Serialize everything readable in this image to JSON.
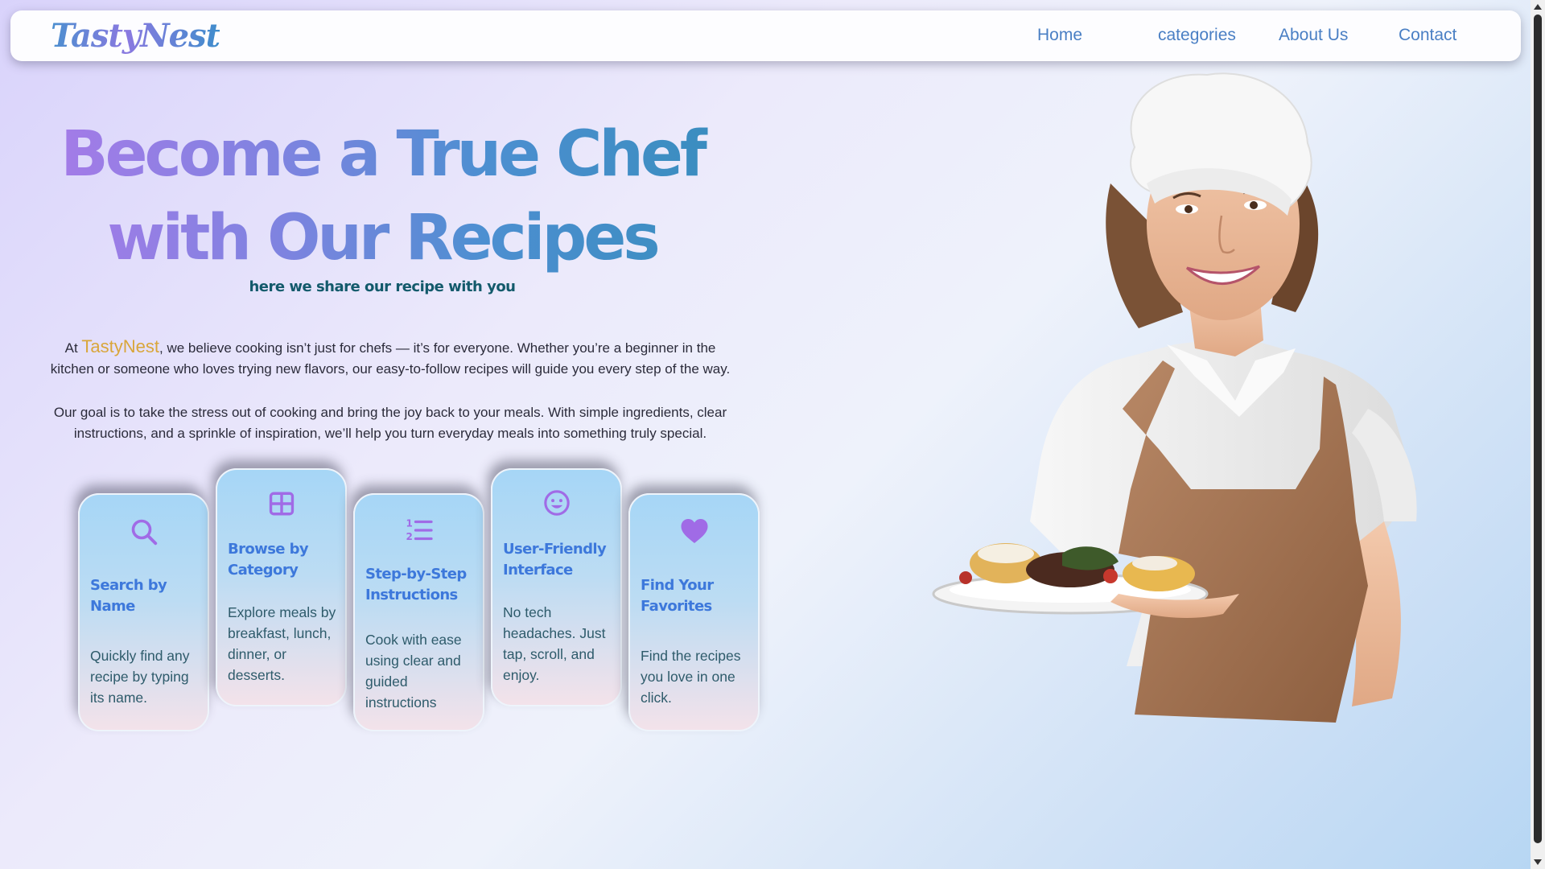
{
  "navbar": {
    "logo": "TastyNest",
    "links": [
      "Home",
      "categories",
      "About Us",
      "Contact"
    ]
  },
  "hero": {
    "title_line1": "Become a True Chef",
    "title_line2": "with Our Recipes",
    "subtitle": "here we share our recipe with you",
    "para1_prefix": "At ",
    "para1_brand": "TastyNest",
    "para1_rest": ", we believe cooking isn’t just for chefs — it’s for everyone. Whether you’re a beginner in the kitchen or someone who loves trying new flavors, our easy-to-follow recipes will guide you every step of the way.",
    "para2": "Our goal is to take the stress out of cooking and bring the joy back to your meals. With simple ingredients, clear instructions, and a sprinkle of inspiration, we’ll help you turn everyday meals into something truly special."
  },
  "features": [
    {
      "icon": "search-icon",
      "title": "Search by Name",
      "text": "Quickly find any recipe by typing its name."
    },
    {
      "icon": "grid-icon",
      "title": "Browse by Category",
      "text": "Explore meals by breakfast, lunch, dinner, or desserts."
    },
    {
      "icon": "list-numbers-icon",
      "title": "Step-by-Step Instructions",
      "text": "Cook with ease using clear and guided instructions"
    },
    {
      "icon": "smile-icon",
      "title": "User-Friendly Interface",
      "text": "No tech headaches. Just tap, scroll, and enjoy."
    },
    {
      "icon": "heart-icon",
      "title": "Find Your Favorites",
      "text": "Find the recipes you love in one click."
    }
  ],
  "colors": {
    "accent_blue": "#3d78db",
    "accent_purple": "#a57be8",
    "brand_gold": "#d9a63a",
    "subtitle_teal": "#135a6b"
  }
}
